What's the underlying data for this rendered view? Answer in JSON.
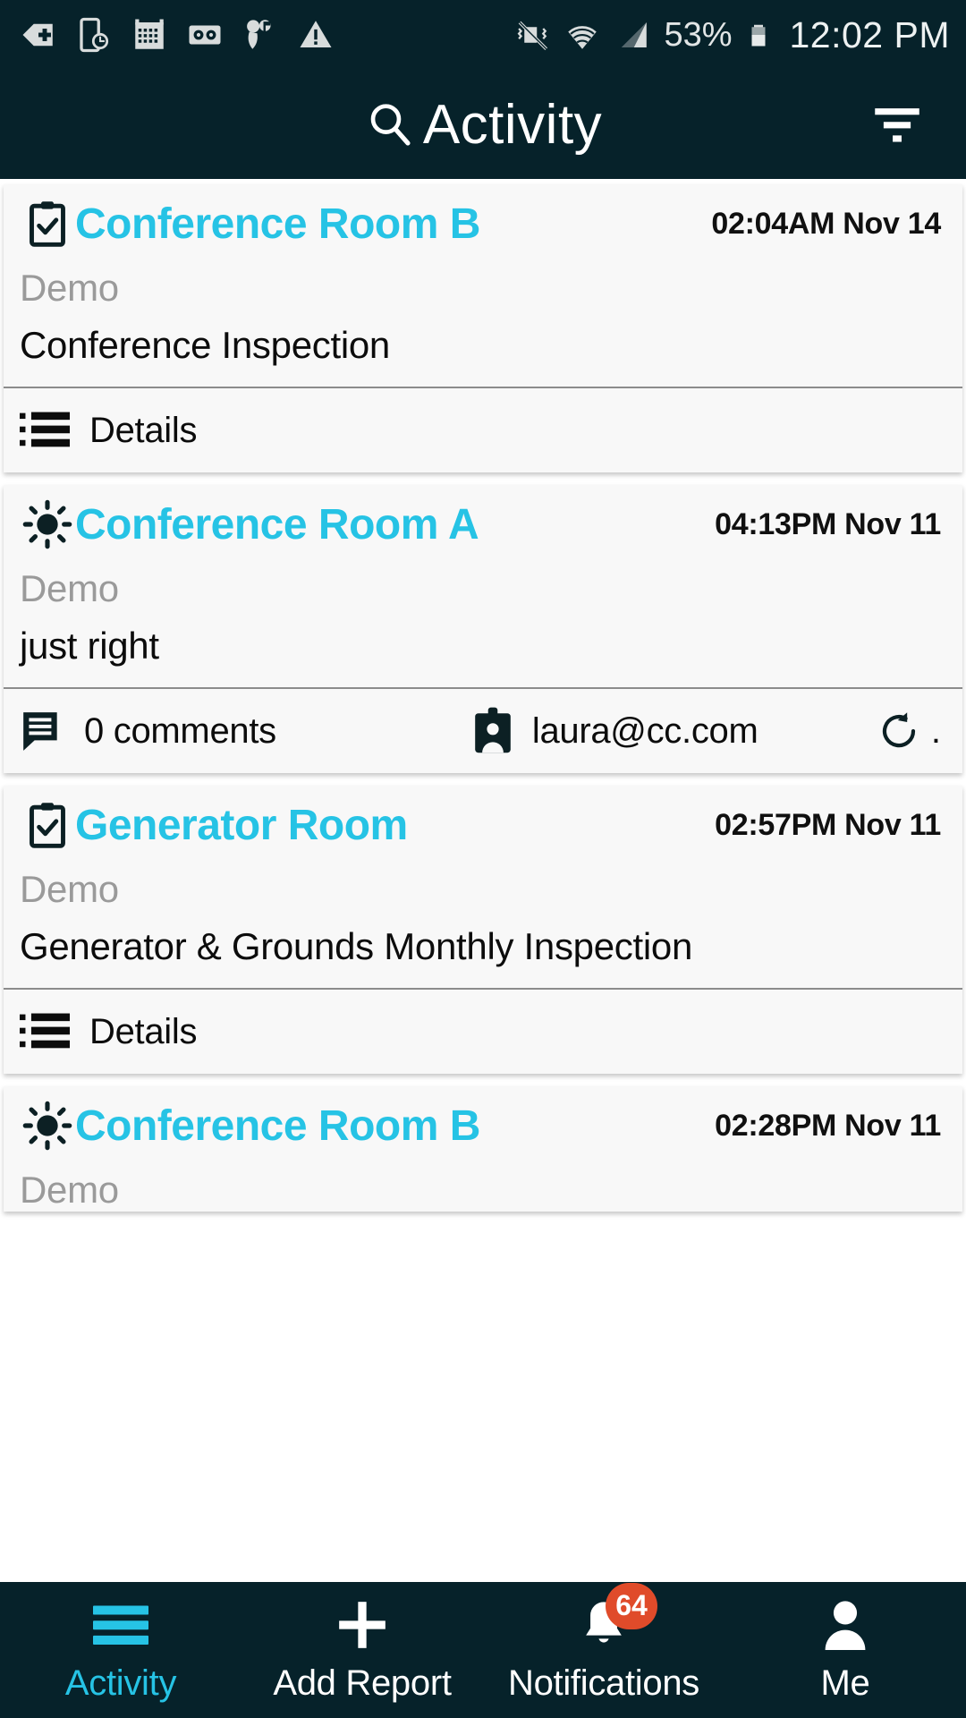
{
  "status_bar": {
    "icons": [
      "back-plus-icon",
      "device-clock-icon",
      "calendar-icon",
      "voicemail-icon",
      "music-share-icon",
      "warning-icon",
      "vibrate-off-icon",
      "wifi-icon",
      "signal-icon"
    ],
    "battery_percent": "53%",
    "clock": "12:02 PM"
  },
  "header": {
    "title": "Activity",
    "search_icon": "search-icon",
    "filter_icon": "filter-icon"
  },
  "colors": {
    "accent": "#26c3e5",
    "app_bar": "#06222a",
    "badge": "#e04b2a",
    "card_bg": "#f8f8f8",
    "muted_text": "#9a9a9a"
  },
  "cards": [
    {
      "icon": "clipboard-check-icon",
      "title": "Conference Room B",
      "time": "02:04AM Nov 14",
      "subtitle": "Demo",
      "description": "Conference Inspection",
      "footer_type": "details",
      "details_label": "Details"
    },
    {
      "icon": "brightness-sun-icon",
      "title": "Conference Room A",
      "time": "04:13PM Nov 11",
      "subtitle": "Demo",
      "description": "just right",
      "footer_type": "meta",
      "comments_label": "0 comments",
      "author": "laura@cc.com",
      "refresh_dot": "."
    },
    {
      "icon": "clipboard-check-icon",
      "title": "Generator Room",
      "time": "02:57PM Nov 11",
      "subtitle": "Demo",
      "description": "Generator & Grounds Monthly Inspection",
      "footer_type": "details",
      "details_label": "Details"
    },
    {
      "icon": "brightness-sun-icon",
      "title": "Conference Room B",
      "time": "02:28PM Nov 11",
      "subtitle": "Demo",
      "description": "",
      "footer_type": "none"
    }
  ],
  "bottom_nav": [
    {
      "label": "Activity",
      "icon": "hamburger-icon",
      "active": true
    },
    {
      "label": "Add Report",
      "icon": "plus-icon",
      "active": false
    },
    {
      "label": "Notifications",
      "icon": "bell-icon",
      "active": false,
      "badge": "64"
    },
    {
      "label": "Me",
      "icon": "person-icon",
      "active": false
    }
  ]
}
